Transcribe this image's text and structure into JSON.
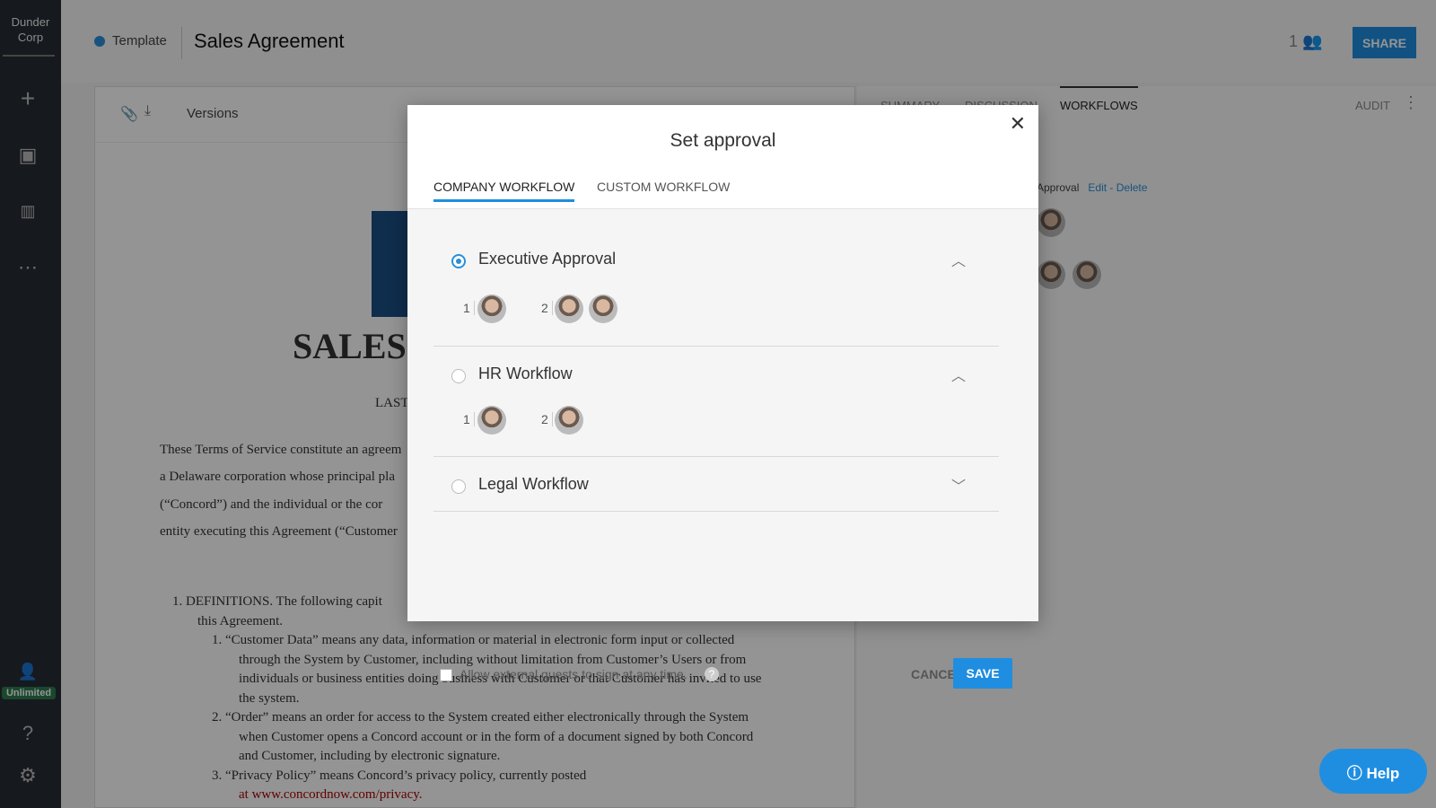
{
  "sidebar": {
    "brand_line1": "Dunder",
    "brand_line2": "Corp",
    "badge": "Unlimited",
    "icons": [
      "plus-icon",
      "inbox-icon",
      "chart-icon",
      "more-icon",
      "add-user-icon",
      "help-icon",
      "gear-icon"
    ]
  },
  "header": {
    "status": "Template",
    "title": "Sales Agreement",
    "collaborator_count": "1",
    "share": "SHARE"
  },
  "doc": {
    "versions": "Versions",
    "heading": "SALES",
    "last": "LAST",
    "lines": [
      "These Terms of Service constitute an agreem",
      "a Delaware corporation whose principal pla",
      "(“Concord”) and the individual or the cor",
      "entity executing this Agreement (“Customer"
    ],
    "def": [
      "1.   DEFINITIONS. The following capit",
      "this Agreement.",
      "1.   “Customer Data” means any data, information or material in electronic form input or collected",
      "through the System by Customer, including without limitation from Customer’s Users or from",
      "individuals or business entities doing business with Customer or that Customer has invited to use",
      "the system.",
      "2.   “Order” means an order for access to the System created either electronically through the System",
      "when Customer opens a Concord account or in the form of a document signed by both Concord",
      "and Customer, including by electronic signature.",
      "3.   “Privacy   Policy”   means   Concord’s   privacy   policy,   currently   posted",
      "at www.concordnow.com/privacy."
    ]
  },
  "right": {
    "tabs": [
      "SUMMARY",
      "DISCUSSION",
      "WORKFLOWS",
      "AUDIT"
    ],
    "approval": "Approval",
    "edit": "Edit",
    "dash": " - ",
    "delete": "Delete"
  },
  "modal": {
    "title": "Set approval",
    "tabs": [
      "COMPANY WORKFLOW",
      "CUSTOM WORKFLOW"
    ],
    "workflows": [
      {
        "name": "Executive Approval",
        "selected": true,
        "expanded": true,
        "steps": [
          "1",
          "2"
        ]
      },
      {
        "name": "HR Workflow",
        "selected": false,
        "expanded": true,
        "steps": [
          "1",
          "2"
        ]
      },
      {
        "name": "Legal Workflow",
        "selected": false,
        "expanded": false
      }
    ],
    "guests_label": "Allow external guests to sign at any time.",
    "cancel": "CANCEL",
    "save": "SAVE"
  },
  "help": "Help",
  "colors": {
    "accent": "#1f8ee0",
    "sidebar": "#262c35"
  }
}
